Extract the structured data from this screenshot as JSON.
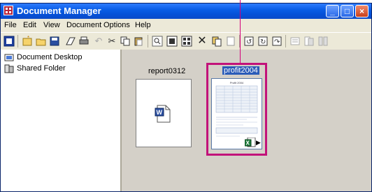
{
  "window": {
    "title": "Document Manager"
  },
  "menubar": {
    "items": [
      "File",
      "Edit",
      "View",
      "Document",
      "Options",
      "Help"
    ]
  },
  "toolbar": {
    "icons": [
      "app-menu-icon",
      "new-folder-icon",
      "open-icon",
      "save-icon",
      "copy-pages-icon",
      "print-icon",
      "undo-icon",
      "cut-icon",
      "copy-icon",
      "paste-icon",
      "zoom-icon",
      "thumbnail-view-icon",
      "list-view-icon",
      "delete-icon",
      "duplicate-icon",
      "insert-icon",
      "rotate-left-icon",
      "rotate-right-icon",
      "rotate-180-icon",
      "align-icon",
      "stack-icon",
      "arrange-icon"
    ]
  },
  "tree": {
    "items": [
      {
        "label": "Document Desktop",
        "icon": "desktop-folder-icon"
      },
      {
        "label": "Shared Folder",
        "icon": "shared-folder-icon"
      }
    ]
  },
  "documents": [
    {
      "name": "report0312",
      "type": "word-document-icon",
      "selected": false
    },
    {
      "name": "profit2004",
      "type": "excel-document-icon",
      "selected": true,
      "preview_title": "Profit 2004"
    }
  ],
  "colors": {
    "highlight": "#c2127a",
    "titlebar": "#0a5ee6",
    "selection": "#2a5bb8"
  }
}
